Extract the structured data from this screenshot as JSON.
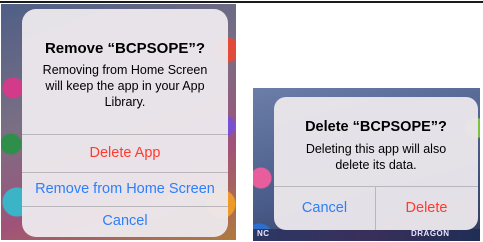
{
  "colors": {
    "action_blue": "#2d7ff9",
    "destructive_red": "#ff3b30",
    "sheet_bg": "#ece8ec"
  },
  "remove_sheet": {
    "title": "Remove “BCPSOPE”?",
    "message_lines": [
      "Removing from Home Screen",
      "will keep the app in your App",
      "Library."
    ],
    "delete_app_label": "Delete App",
    "remove_from_home_label": "Remove from Home Screen",
    "cancel_label": "Cancel"
  },
  "delete_alert": {
    "title": "Delete “BCPSOPE”?",
    "message_lines": [
      "Deleting this app will also",
      "delete its data."
    ],
    "cancel_label": "Cancel",
    "delete_label": "Delete"
  },
  "background": {
    "left_strip_text": "NC",
    "right_strip_text": "DRAGON"
  }
}
